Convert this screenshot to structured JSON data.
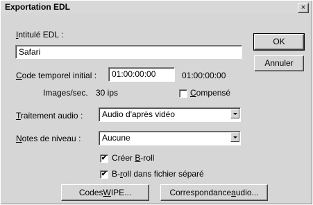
{
  "window": {
    "title": "Exportation EDL",
    "close_symbol": "×"
  },
  "edl_label": {
    "prefix": "",
    "mnemonic": "I",
    "rest": "ntitulé EDL :"
  },
  "edl_value": "Safari",
  "ok_button": "OK",
  "cancel_button": "Annuler",
  "timecode": {
    "label_mnemonic": "C",
    "label_rest": "ode temporel initial :",
    "value": "01:00:00:00",
    "display": "01:00:00:00"
  },
  "fps": {
    "label": "Images/sec.",
    "value": "30 ips"
  },
  "compensated": {
    "checked": false,
    "mnemonic": "C",
    "rest": "ompensé"
  },
  "audio": {
    "label_mnemonic": "T",
    "label_rest": "raitement audio :",
    "selected": "Audio d'après vidéo"
  },
  "level_notes": {
    "label_mnemonic": "N",
    "label_rest": "otes de niveau :",
    "selected": "Aucune"
  },
  "create_broll": {
    "checked": true,
    "prefix": "Créer ",
    "mnemonic": "B",
    "rest": "-roll"
  },
  "broll_separate": {
    "checked": true,
    "prefix": "B-",
    "mnemonic": "r",
    "rest": "oll dans fichier séparé"
  },
  "wipe_button": {
    "prefix": "Codes ",
    "mnemonic": "W",
    "rest": "IPE..."
  },
  "audio_match_button": {
    "prefix": "Correspondance ",
    "mnemonic": "a",
    "rest": "udio..."
  },
  "check_mark": "✔"
}
